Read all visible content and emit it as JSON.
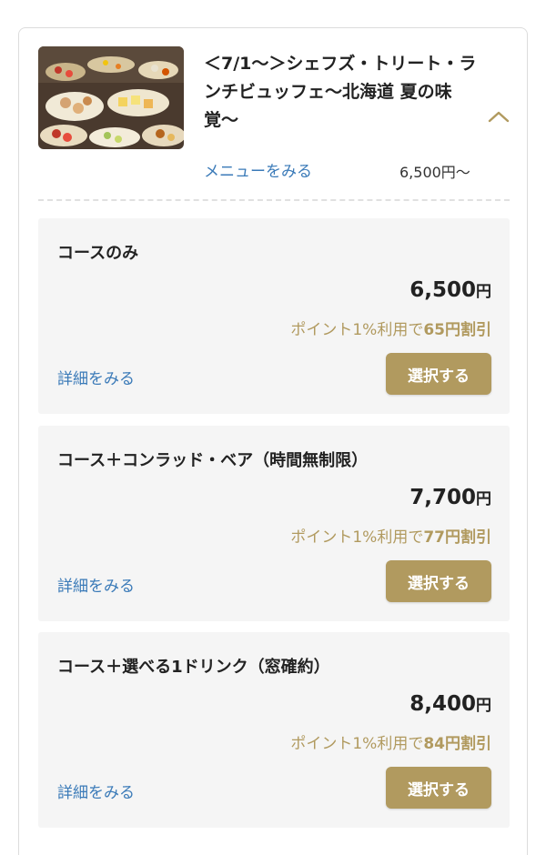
{
  "plan": {
    "title": "＜7/1〜＞シェフズ・トリート・ランチビュッフェ〜北海道 夏の味覚〜",
    "menu_link": "メニューをみる",
    "price_from": "6,500円〜",
    "thumbnail_icon": "buffet-food-photo"
  },
  "options": [
    {
      "name": "コースのみ",
      "price": "6,500",
      "currency": "円",
      "point_text": "ポイント1%利用で",
      "point_discount": "65円割引",
      "detail_link": "詳細をみる",
      "select_label": "選択する"
    },
    {
      "name": "コース＋コンラッド・ベア（時間無制限）",
      "price": "7,700",
      "currency": "円",
      "point_text": "ポイント1%利用で",
      "point_discount": "77円割引",
      "detail_link": "詳細をみる",
      "select_label": "選択する"
    },
    {
      "name": "コース＋選べる1ドリンク（窓確約）",
      "price": "8,400",
      "currency": "円",
      "point_text": "ポイント1%利用で",
      "point_discount": "84円割引",
      "detail_link": "詳細をみる",
      "select_label": "選択する"
    }
  ],
  "colors": {
    "accent_gold": "#b19a5f",
    "link_blue": "#3a7ab8",
    "option_bg": "#f5f5f5"
  }
}
